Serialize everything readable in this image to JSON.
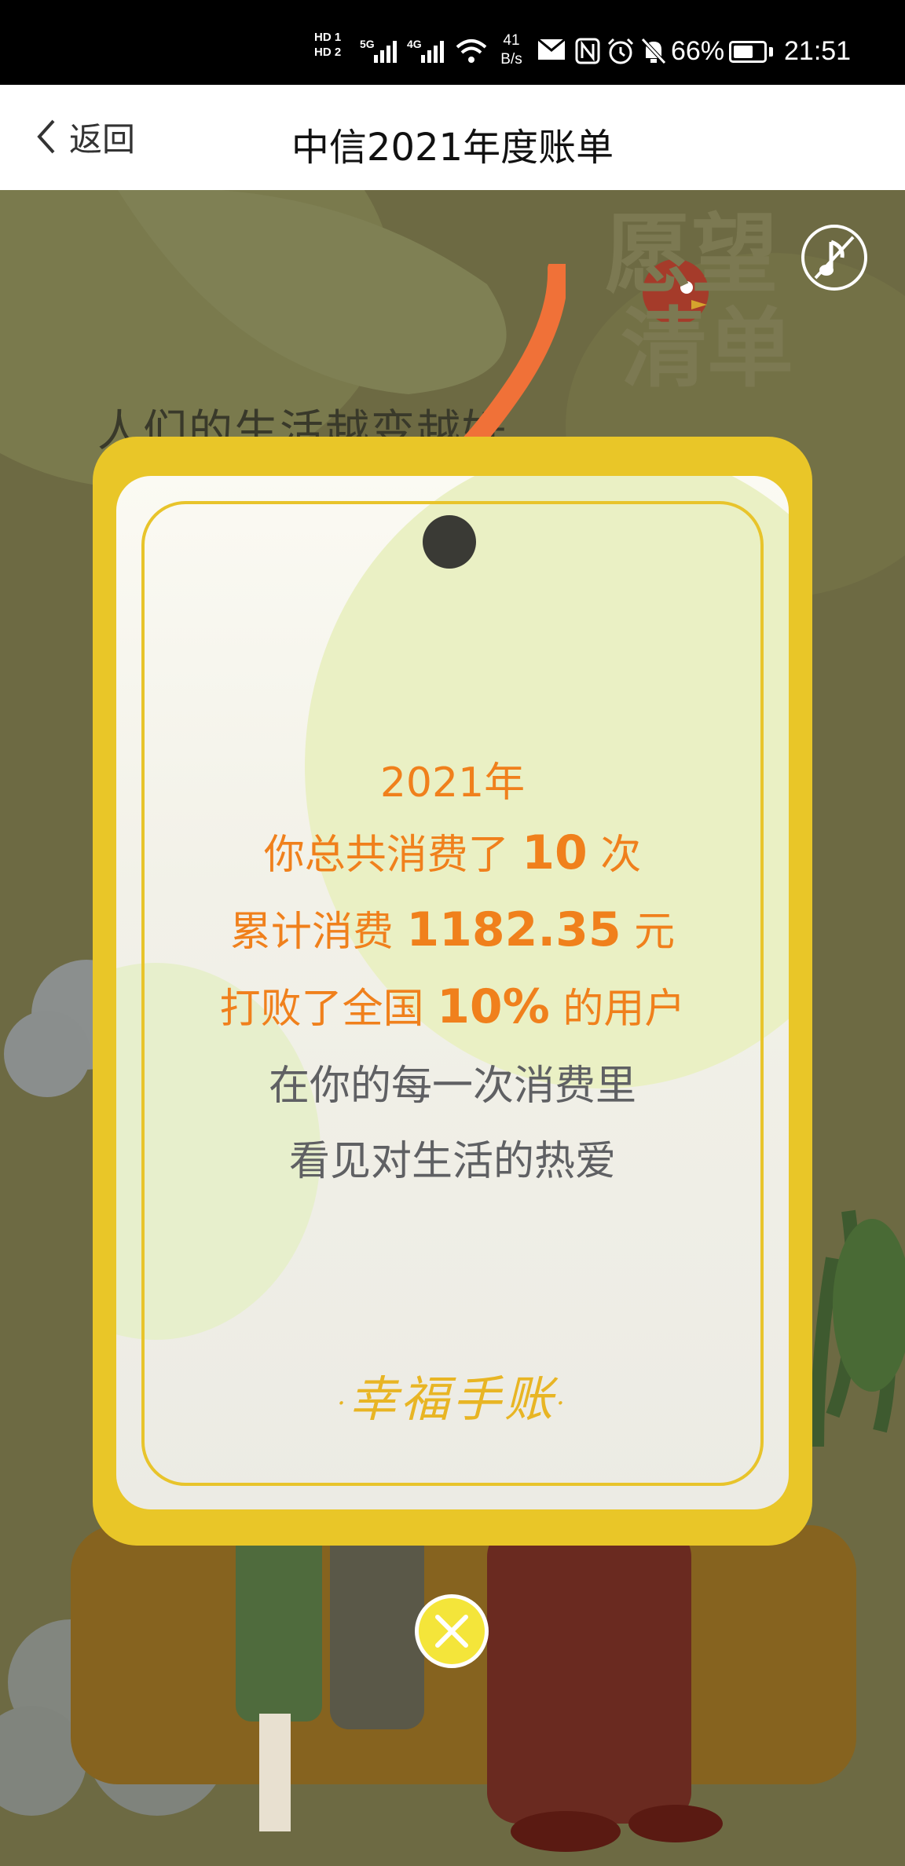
{
  "status_bar": {
    "hd1": "HD 1",
    "hd2": "HD 2",
    "gen1": "5G",
    "gen2": "4G",
    "net_speed_value": "41",
    "net_speed_unit": "B/s",
    "battery_percent": "66%",
    "battery_level": 0.66,
    "time": "21:51"
  },
  "nav": {
    "back_label": "返回",
    "title": "中信2021年度账单"
  },
  "background": {
    "headline": "人们的生活越变越好"
  },
  "card": {
    "year_line": "2021年",
    "count_prefix": "你总共消费了",
    "count_value": "10",
    "count_suffix": "次",
    "total_prefix": "累计消费",
    "total_value": "1182.35",
    "total_suffix": "元",
    "rank_prefix": "打败了全国",
    "rank_value": "10%",
    "rank_suffix": "的用户",
    "line5": "在你的每一次消费里",
    "line6": "看见对生活的热爱",
    "brand": "幸福手账"
  },
  "icons": {
    "back": "chevron-left-icon",
    "music": "music-note-icon",
    "close": "close-icon"
  },
  "colors": {
    "card_frame": "#e9c628",
    "highlight_text": "#f0801c",
    "body_text": "#5f6063",
    "tag_ribbon": "#f07138",
    "close_button": "#f4e53a"
  }
}
